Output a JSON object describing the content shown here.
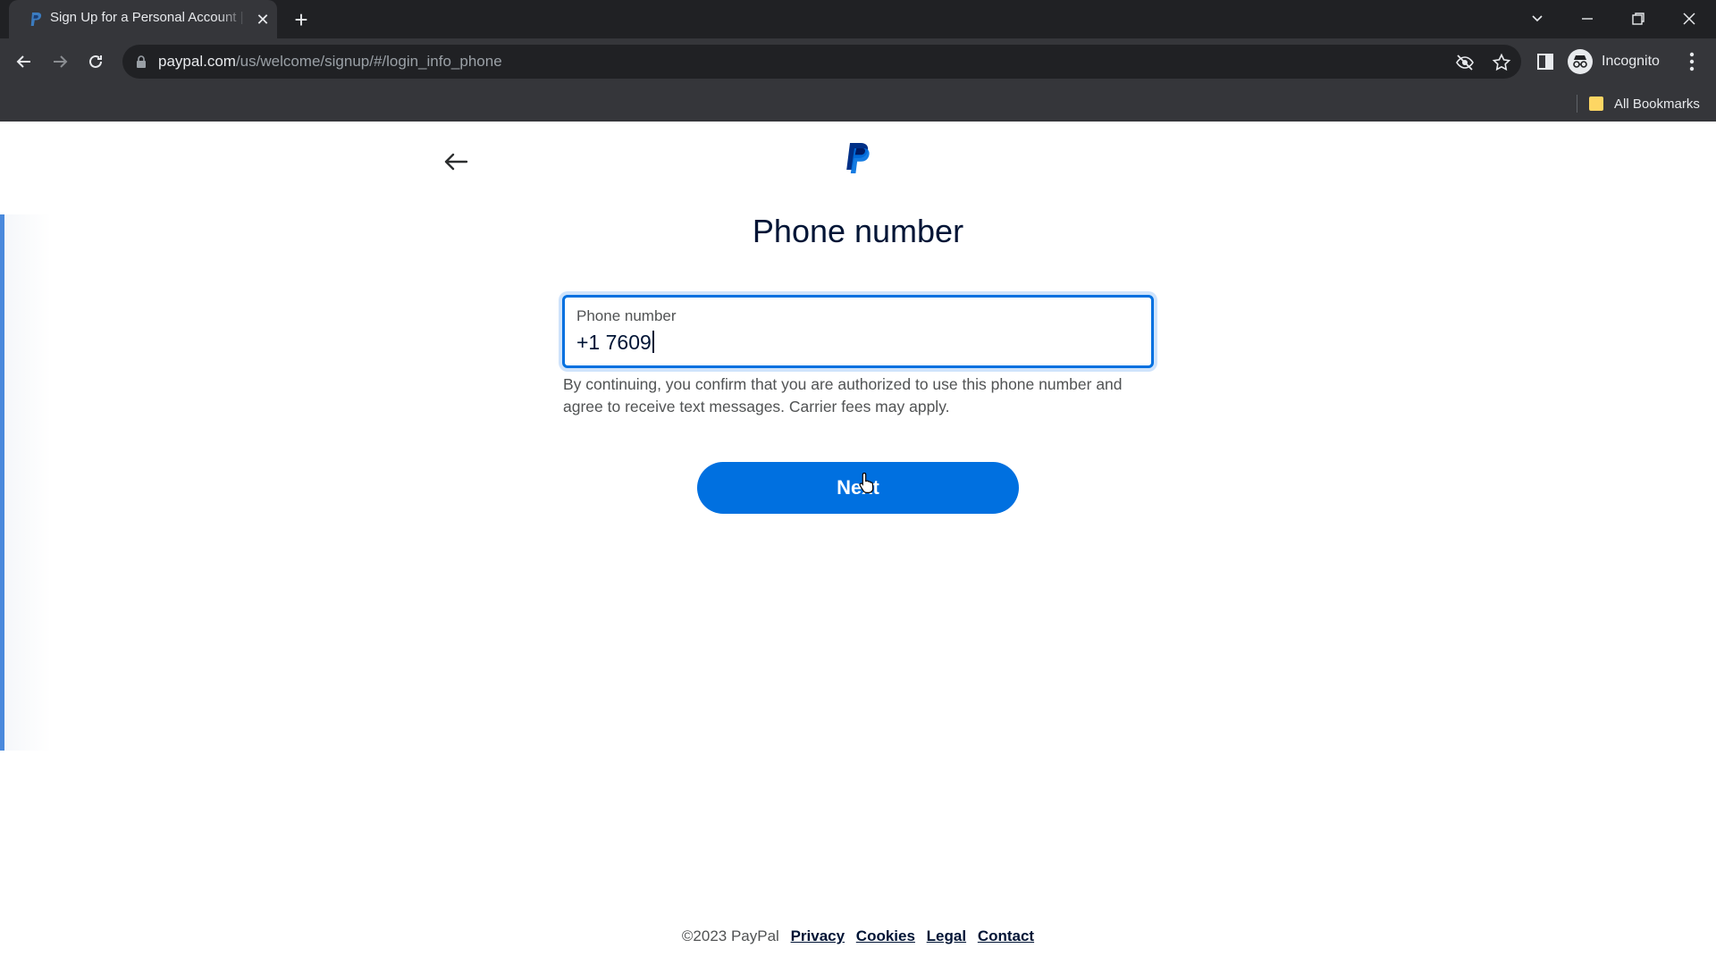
{
  "browser": {
    "tab_title": "Sign Up for a Personal Account | PayPal",
    "url_host": "paypal.com",
    "url_path": "/us/welcome/signup/#/login_info_phone",
    "profile_label": "Incognito",
    "bookmarks_label": "All Bookmarks"
  },
  "page": {
    "title": "Phone number",
    "phone_field": {
      "label": "Phone number",
      "value": "+1 7609"
    },
    "consent_text": "By continuing, you confirm that you are authorized to use this phone number and agree to receive text messages. Carrier fees may apply.",
    "next_label": "Next"
  },
  "footer": {
    "copyright": "©2023 PayPal",
    "links": [
      "Privacy",
      "Cookies",
      "Legal",
      "Contact"
    ]
  },
  "colors": {
    "brand_blue": "#0070e0",
    "text_dark": "#001435"
  }
}
